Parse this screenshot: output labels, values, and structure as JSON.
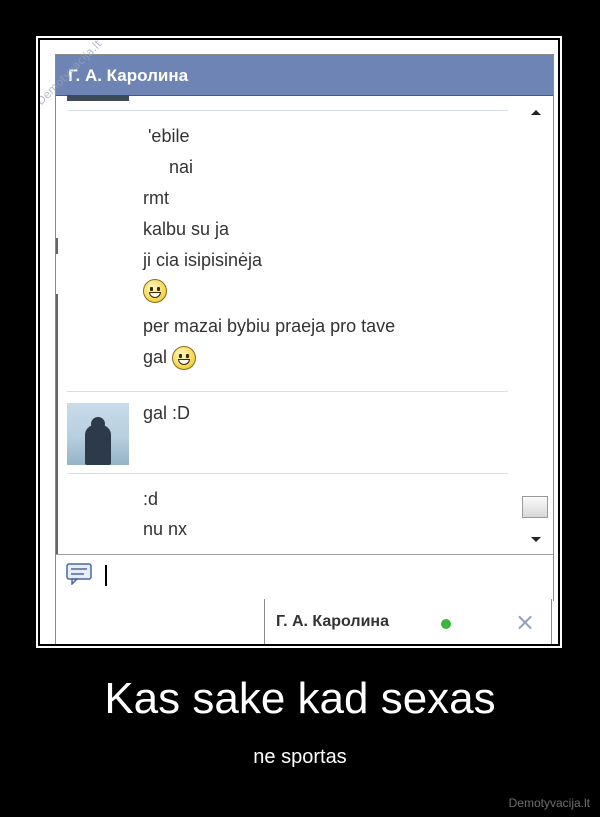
{
  "chat": {
    "header_name": "Г. А. Каролина",
    "messages_block1": [
      "'ebile",
      "nai",
      "rmt",
      "kalbu su ja",
      "ji cia isipisinėja",
      "per mazai bybiu praeja pro tave",
      "gal"
    ],
    "message_block2": "gal :D",
    "messages_block3": [
      ":d",
      "nu nx"
    ],
    "tab_name": "Г. А. Каролина",
    "close_label": "×"
  },
  "watermark": "Demotyvacija.lt",
  "caption": {
    "title": "Kas sake kad sexas",
    "subtitle": "ne sportas"
  },
  "credit": "Demotyvacija.lt",
  "colors": {
    "header": "#6d84b4",
    "online": "#3db53d",
    "background": "#000000"
  },
  "icons": [
    "chat-bubble-icon",
    "smiley-icon",
    "close-icon",
    "scroll-up-icon",
    "scroll-down-icon"
  ]
}
